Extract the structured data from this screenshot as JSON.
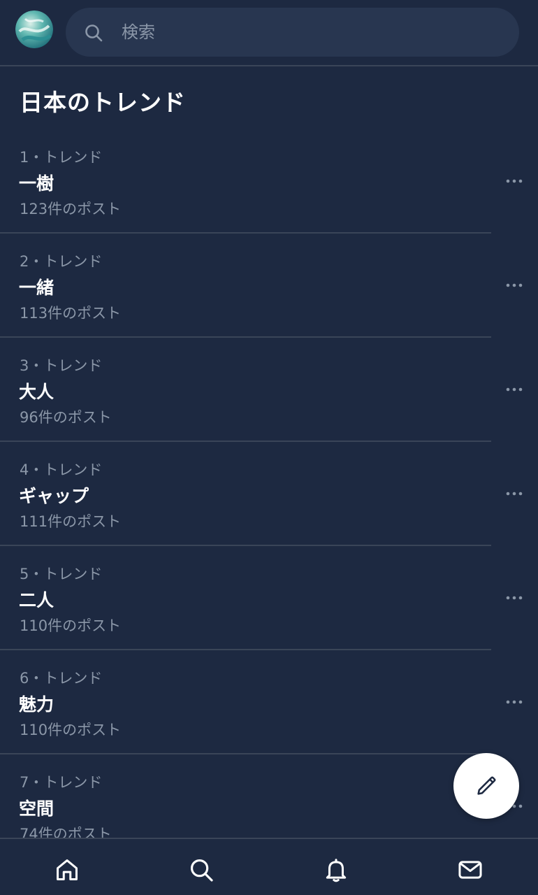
{
  "search": {
    "placeholder": "検索"
  },
  "section": {
    "title": "日本のトレンド"
  },
  "trends": [
    {
      "rank": "1・トレンド",
      "name": "一樹",
      "count": "123件のポスト"
    },
    {
      "rank": "2・トレンド",
      "name": "一緒",
      "count": "113件のポスト"
    },
    {
      "rank": "3・トレンド",
      "name": "大人",
      "count": "96件のポスト"
    },
    {
      "rank": "4・トレンド",
      "name": "ギャップ",
      "count": "111件のポスト"
    },
    {
      "rank": "5・トレンド",
      "name": "二人",
      "count": "110件のポスト"
    },
    {
      "rank": "6・トレンド",
      "name": "魅力",
      "count": "110件のポスト"
    },
    {
      "rank": "7・トレンド",
      "name": "空間",
      "count": "74件のポスト"
    }
  ],
  "icons": {
    "search": "search-icon",
    "more": "more-horizontal-icon",
    "compose": "pencil-icon",
    "nav": [
      "home-icon",
      "search-icon",
      "bell-icon",
      "mail-icon"
    ]
  },
  "colors": {
    "background": "#1d2941",
    "search_bg": "#283650",
    "divider": "#3a4558",
    "text_primary": "#ffffff",
    "text_secondary": "#8b97a8"
  }
}
